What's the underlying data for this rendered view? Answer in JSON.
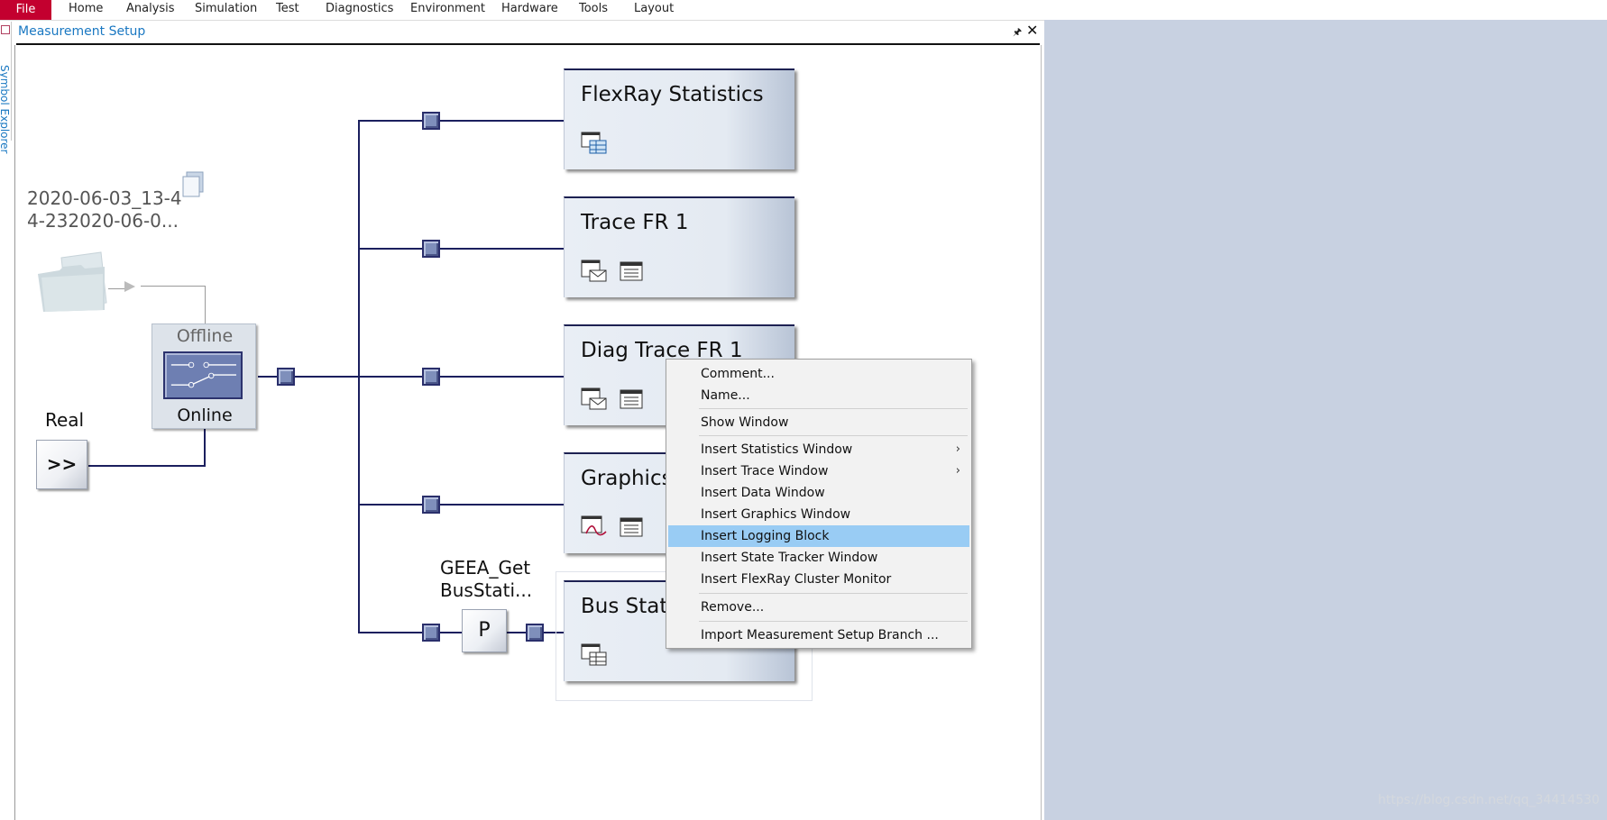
{
  "menubar": {
    "file": "File",
    "items": [
      "Home",
      "Analysis",
      "Simulation",
      "Test",
      "Diagnostics",
      "Environment",
      "Hardware",
      "Tools",
      "Layout"
    ]
  },
  "side_tab": {
    "label": "Symbol Explorer"
  },
  "window": {
    "title": "Measurement Setup",
    "pin": "🖈",
    "close": "✕"
  },
  "source": {
    "file_line1": "2020-06-03_13-4",
    "file_line2": "4-232020-06-0...",
    "offline_label": "Offline",
    "online_label": "Online",
    "real_label": "Real",
    "real_button": ">>"
  },
  "blocks": [
    {
      "title": "FlexRay Statistics"
    },
    {
      "title": "Trace FR 1"
    },
    {
      "title": "Diag Trace FR 1"
    },
    {
      "title": "Graphics"
    },
    {
      "title": "Bus Stati"
    }
  ],
  "program_node": {
    "name_line1": "GEEA_Get",
    "name_line2": "BusStati...",
    "label": "P"
  },
  "context_menu": {
    "items": [
      {
        "label": "Comment..."
      },
      {
        "label": "Name..."
      },
      {
        "label": "Show Window"
      },
      {
        "label": "Insert Statistics Window",
        "submenu": true
      },
      {
        "label": "Insert Trace Window",
        "submenu": true
      },
      {
        "label": "Insert Data Window"
      },
      {
        "label": "Insert Graphics Window"
      },
      {
        "label": "Insert Logging Block",
        "highlighted": true
      },
      {
        "label": "Insert State Tracker Window"
      },
      {
        "label": "Insert FlexRay Cluster Monitor"
      },
      {
        "label": "Remove..."
      },
      {
        "label": "Import Measurement Setup Branch ..."
      }
    ],
    "submenu_arrow": "›"
  },
  "watermark": "https://blog.csdn.net/qq_34414530",
  "colors": {
    "file_menu": "#c3002f",
    "link_blue": "#1a78c2",
    "line_navy": "#1b1f5e",
    "highlight": "#99ccf4",
    "right_pane": "#c8d1e1"
  }
}
